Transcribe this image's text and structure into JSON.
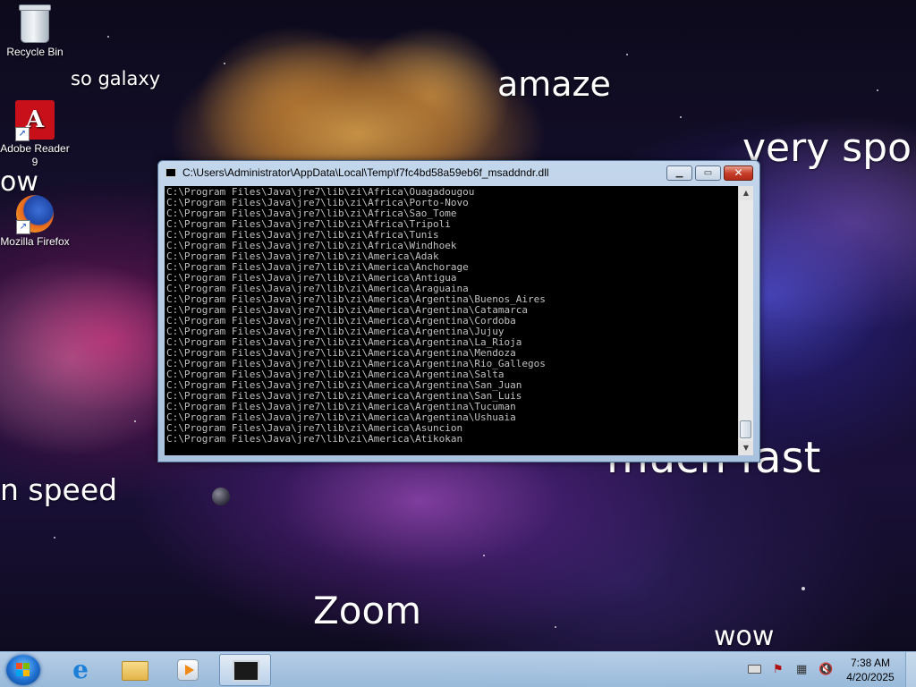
{
  "desktop": {
    "meme_texts": {
      "so_galaxy": "so galaxy",
      "amaze": "amaze",
      "very_spo": "very spo",
      "wow_left": "ow",
      "much_fast": "much fast",
      "much_speed": "n speed",
      "zoom": "Zoom",
      "wow_bottom": "wow"
    },
    "icons": [
      {
        "label": "Recycle Bin",
        "icon": "recycle-bin-icon"
      },
      {
        "label": "Adobe Reader 9",
        "icon": "adobe-reader-icon"
      },
      {
        "label": "Mozilla Firefox",
        "icon": "firefox-icon"
      }
    ]
  },
  "console": {
    "title": "C:\\Users\\Administrator\\AppData\\Local\\Temp\\f7fc4bd58a59eb6f_msaddndr.dll",
    "buttons": {
      "minimize": "▁",
      "maximize": "▭",
      "close": "✕"
    },
    "lines": [
      "C:\\Program Files\\Java\\jre7\\lib\\zi\\Africa\\Ouagadougou",
      "C:\\Program Files\\Java\\jre7\\lib\\zi\\Africa\\Porto-Novo",
      "C:\\Program Files\\Java\\jre7\\lib\\zi\\Africa\\Sao_Tome",
      "C:\\Program Files\\Java\\jre7\\lib\\zi\\Africa\\Tripoli",
      "C:\\Program Files\\Java\\jre7\\lib\\zi\\Africa\\Tunis",
      "C:\\Program Files\\Java\\jre7\\lib\\zi\\Africa\\Windhoek",
      "C:\\Program Files\\Java\\jre7\\lib\\zi\\America\\Adak",
      "C:\\Program Files\\Java\\jre7\\lib\\zi\\America\\Anchorage",
      "C:\\Program Files\\Java\\jre7\\lib\\zi\\America\\Antigua",
      "C:\\Program Files\\Java\\jre7\\lib\\zi\\America\\Araguaina",
      "C:\\Program Files\\Java\\jre7\\lib\\zi\\America\\Argentina\\Buenos_Aires",
      "C:\\Program Files\\Java\\jre7\\lib\\zi\\America\\Argentina\\Catamarca",
      "C:\\Program Files\\Java\\jre7\\lib\\zi\\America\\Argentina\\Cordoba",
      "C:\\Program Files\\Java\\jre7\\lib\\zi\\America\\Argentina\\Jujuy",
      "C:\\Program Files\\Java\\jre7\\lib\\zi\\America\\Argentina\\La_Rioja",
      "C:\\Program Files\\Java\\jre7\\lib\\zi\\America\\Argentina\\Mendoza",
      "C:\\Program Files\\Java\\jre7\\lib\\zi\\America\\Argentina\\Rio_Gallegos",
      "C:\\Program Files\\Java\\jre7\\lib\\zi\\America\\Argentina\\Salta",
      "C:\\Program Files\\Java\\jre7\\lib\\zi\\America\\Argentina\\San_Juan",
      "C:\\Program Files\\Java\\jre7\\lib\\zi\\America\\Argentina\\San_Luis",
      "C:\\Program Files\\Java\\jre7\\lib\\zi\\America\\Argentina\\Tucuman",
      "C:\\Program Files\\Java\\jre7\\lib\\zi\\America\\Argentina\\Ushuaia",
      "C:\\Program Files\\Java\\jre7\\lib\\zi\\America\\Asuncion",
      "C:\\Program Files\\Java\\jre7\\lib\\zi\\America\\Atikokan"
    ],
    "colors": {
      "background": "#000000",
      "text": "#c0c0c0"
    }
  },
  "taskbar": {
    "pinned": [
      {
        "name": "internet-explorer",
        "icon": "internet-explorer-icon"
      },
      {
        "name": "file-explorer",
        "icon": "folder-icon"
      },
      {
        "name": "media-player",
        "icon": "media-player-icon"
      },
      {
        "name": "command-window",
        "icon": "console-window-icon"
      }
    ],
    "tray": {
      "time": "7:38 AM",
      "date": "4/20/2025"
    },
    "colors": {
      "bar": "#a9c6e6",
      "start_orb": "#1f6fd0"
    }
  }
}
